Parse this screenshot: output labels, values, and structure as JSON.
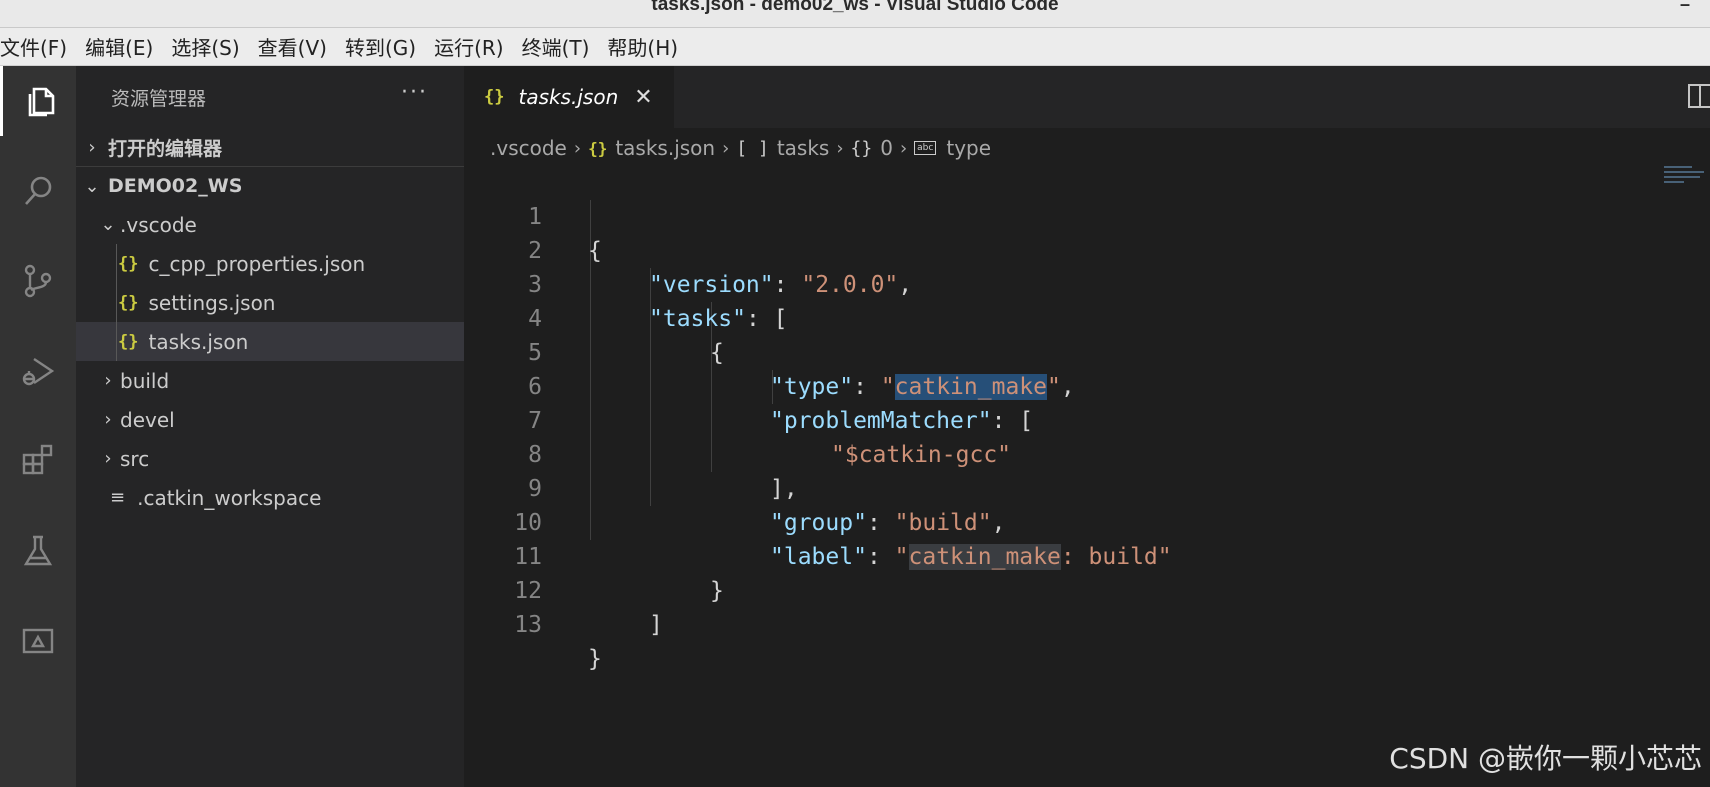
{
  "window": {
    "title": "tasks.json - demo02_ws - Visual Studio Code",
    "minimize_glyph": "–"
  },
  "menu": [
    "文件(F)",
    "编辑(E)",
    "选择(S)",
    "查看(V)",
    "转到(G)",
    "运行(R)",
    "终端(T)",
    "帮助(H)"
  ],
  "activity_bar": [
    "files-icon",
    "search-icon",
    "source-control-icon",
    "run-debug-icon",
    "extensions-icon",
    "testing-icon",
    "remote-explorer-icon"
  ],
  "sidebar": {
    "title": "资源管理器",
    "more": "···",
    "open_editors": "打开的编辑器",
    "workspace": "DEMO02_WS",
    "tree": {
      "vscode_folder": ".vscode",
      "files": [
        "c_cpp_properties.json",
        "settings.json",
        "tasks.json"
      ],
      "folders": [
        "build",
        "devel",
        "src"
      ],
      "catkin_workspace": ".catkin_workspace"
    }
  },
  "editor": {
    "tab": {
      "label": "tasks.json",
      "close": "✕"
    },
    "breadcrumb": [
      ".vscode",
      "tasks.json",
      "tasks",
      "0",
      "type"
    ],
    "breadcrumb_symbols": {
      "json": "{}",
      "array": "[ ]",
      "object": "{}",
      "string": "abc"
    },
    "code": [
      "{",
      "\"version\": \"2.0.0\",",
      "\"tasks\": [",
      "{",
      "\"type\": \"catkin_make\",",
      "\"problemMatcher\": [",
      "\"$catkin-gcc\"",
      "],",
      "\"group\": \"build\",",
      "\"label\": \"catkin_make: build\"",
      "}",
      "]",
      "}"
    ],
    "line_numbers": [
      "1",
      "2",
      "3",
      "4",
      "5",
      "6",
      "7",
      "8",
      "9",
      "10",
      "11",
      "12",
      "13"
    ]
  },
  "watermark": "CSDN @嵌你一颗小芯芯",
  "colors": {
    "accent_selection": "#264f78",
    "json_icon": "#cbcb41",
    "key": "#9cdcfe",
    "string": "#ce9178"
  }
}
